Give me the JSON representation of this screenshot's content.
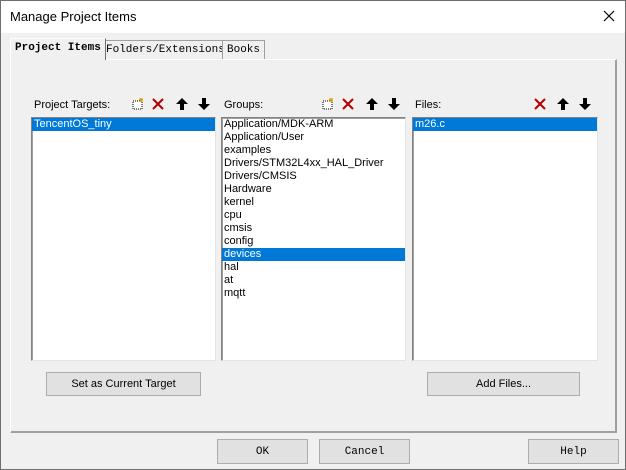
{
  "window": {
    "title": "Manage Project Items"
  },
  "tabs": [
    {
      "label": "Project Items"
    },
    {
      "label": "Folders/Extensions"
    },
    {
      "label": "Books"
    }
  ],
  "targets": {
    "label": "Project Targets:",
    "items": [
      "TencentOS_tiny"
    ],
    "selected_index": 0
  },
  "groups": {
    "label": "Groups:",
    "items": [
      "Application/MDK-ARM",
      "Application/User",
      "examples",
      "Drivers/STM32L4xx_HAL_Driver",
      "Drivers/CMSIS",
      "Hardware",
      "kernel",
      "cpu",
      "cmsis",
      "config",
      "devices",
      "hal",
      "at",
      "mqtt"
    ],
    "selected_index": 10
  },
  "files": {
    "label": "Files:",
    "items": [
      "m26.c"
    ],
    "selected_index": 0
  },
  "buttons": {
    "set_current_target": "Set as Current Target",
    "add_files": "Add Files...",
    "ok": "OK",
    "cancel": "Cancel",
    "help": "Help"
  },
  "icons": {
    "new": "new-item-icon",
    "delete": "delete-icon",
    "up": "move-up-icon",
    "down": "move-down-icon",
    "close": "close-icon"
  },
  "colors": {
    "selection": "#0078d7",
    "delete_x": "#c00000"
  }
}
